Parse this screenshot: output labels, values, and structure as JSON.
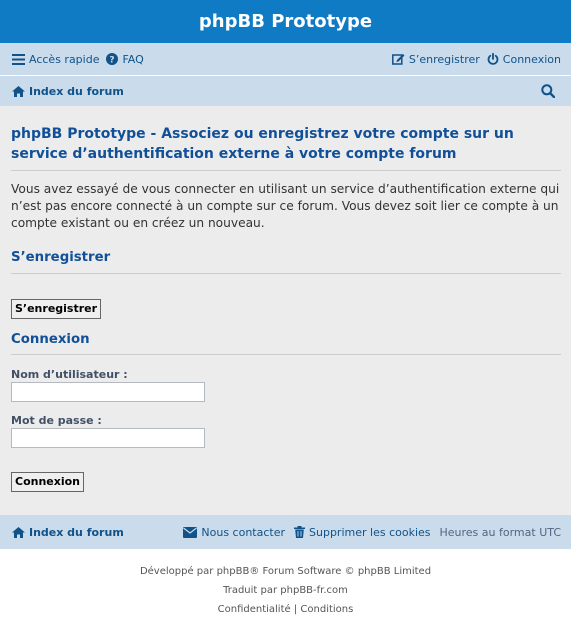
{
  "header": {
    "site_title": "phpBB Prototype"
  },
  "nav": {
    "quick_access": "Accès rapide",
    "faq": "FAQ",
    "register": "S’enregistrer",
    "login": "Connexion",
    "forum_index": "Index du forum"
  },
  "main": {
    "page_title": "phpBB Prototype - Associez ou enregistrez votre compte sur un service d’authentification externe à votre compte forum",
    "intro": "Vous avez essayé de vous connecter en utilisant un service d’authentification externe qui n’est pas encore connecté à un compte sur ce forum. Vous devez soit lier ce compte à un compte existant ou en créez un nouveau.",
    "register_heading": "S’enregistrer",
    "register_button": "S’enregistrer",
    "login_heading": "Connexion",
    "username_label": "Nom d’utilisateur :",
    "username_value": "",
    "password_label": "Mot de passe :",
    "password_value": "",
    "login_button": "Connexion"
  },
  "footer": {
    "forum_index": "Index du forum",
    "contact": "Nous contacter",
    "delete_cookies": "Supprimer les cookies",
    "timezone": "Heures au format UTC",
    "powered_by": "Développé par phpBB® Forum Software © phpBB Limited",
    "translated_by": "Traduit par phpBB-fr.com",
    "privacy": "Confidentialité",
    "separator": "|",
    "terms": "Conditions"
  },
  "colors": {
    "header_bg": "#0e7bc4",
    "navbar_bg": "#cadceb",
    "panel_bg": "#ececec",
    "heading": "#115098",
    "link": "#105289"
  },
  "icons": [
    "bars-icon",
    "question-circle-icon",
    "pencil-square-icon",
    "power-icon",
    "home-icon",
    "search-icon",
    "envelope-icon",
    "trash-icon"
  ]
}
